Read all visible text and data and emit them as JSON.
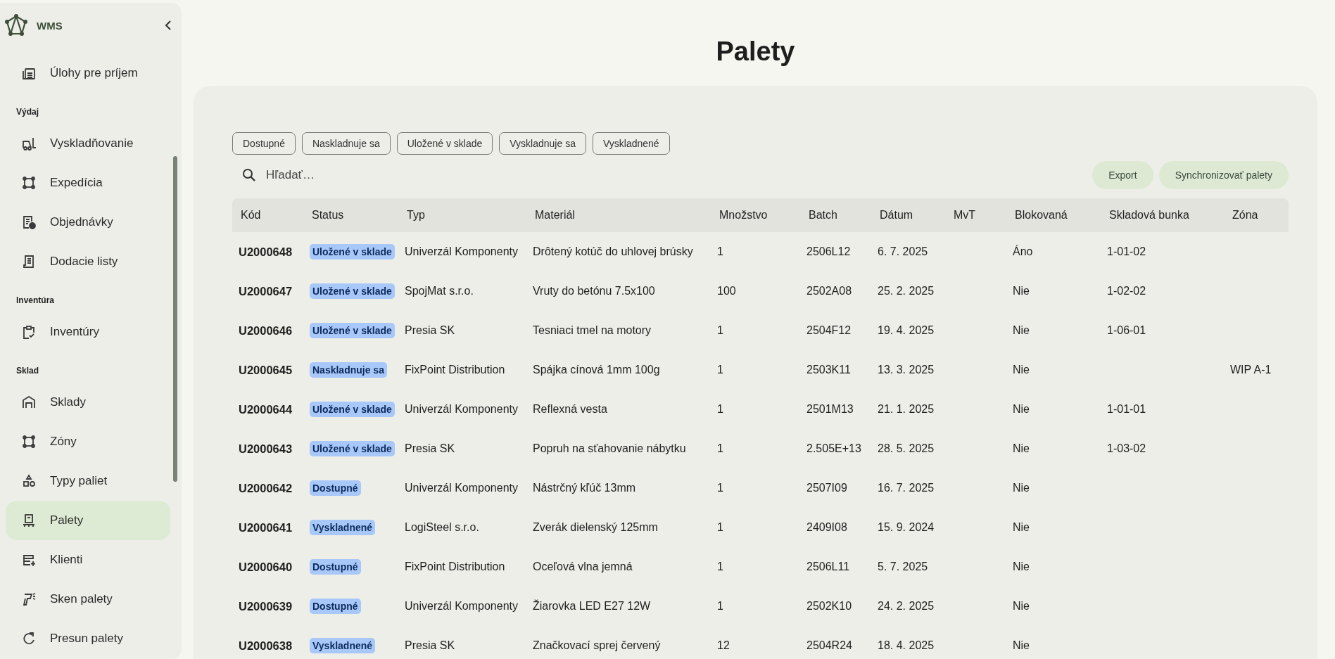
{
  "app": {
    "name": "WMS"
  },
  "sidebar": {
    "sections": [
      {
        "items": [
          {
            "label": "Úlohy pre príjem",
            "selected": false
          }
        ]
      },
      {
        "label": "Výdaj",
        "items": [
          {
            "label": "Vyskladňovanie",
            "selected": false
          },
          {
            "label": "Expedícia",
            "selected": false
          },
          {
            "label": "Objednávky",
            "selected": false
          },
          {
            "label": "Dodacie listy",
            "selected": false
          }
        ]
      },
      {
        "label": "Inventúra",
        "items": [
          {
            "label": "Inventúry",
            "selected": false
          }
        ]
      },
      {
        "label": "Sklad",
        "items": [
          {
            "label": "Sklady",
            "selected": false
          },
          {
            "label": "Zóny",
            "selected": false
          },
          {
            "label": "Typy paliet",
            "selected": false
          },
          {
            "label": "Palety",
            "selected": true
          },
          {
            "label": "Klienti",
            "selected": false
          },
          {
            "label": "Sken palety",
            "selected": false
          },
          {
            "label": "Presun palety",
            "selected": false
          }
        ]
      }
    ]
  },
  "page_title": "Palety",
  "filters": [
    {
      "label": "Dostupné",
      "selected": false
    },
    {
      "label": "Naskladnuje sa",
      "selected": false
    },
    {
      "label": "Uložené v sklade",
      "selected": false
    },
    {
      "label": "Vyskladnuje sa",
      "selected": false
    },
    {
      "label": "Vyskladnené",
      "selected": false
    }
  ],
  "search": {
    "placeholder": "Hľadať…"
  },
  "actions": [
    "Export",
    "Synchronizovať palety"
  ],
  "table": {
    "columns": [
      "Kód",
      "Status",
      "Typ",
      "Materiál",
      "Množstvo",
      "Batch",
      "Dátum",
      "MvT",
      "Blokovaná",
      "Skladová bunka",
      "Zóna"
    ],
    "rows": [
      {
        "code": "U2000648",
        "status": "Uložené v sklade",
        "type": "Univerzál Komponenty",
        "material": "Drôtený kotúč do uhlovej brúsky",
        "quantity": "1",
        "batch": "2506L12",
        "date": "6. 7. 2025",
        "blocked": "Áno",
        "cell": "1-01-02"
      },
      {
        "code": "U2000647",
        "status": "Uložené v sklade",
        "type": "SpojMat s.r.o.",
        "material": "Vruty do betónu 7.5x100",
        "quantity": "100",
        "batch": "2502A08",
        "date": "25. 2. 2025",
        "blocked": "Nie",
        "cell": "1-02-02"
      },
      {
        "code": "U2000646",
        "status": "Uložené v sklade",
        "type": "Presia SK",
        "material": "Tesniaci tmel na motory",
        "quantity": "1",
        "batch": "2504F12",
        "date": "19. 4. 2025",
        "blocked": "Nie",
        "cell": "1-06-01"
      },
      {
        "code": "U2000645",
        "status": "Naskladnuje sa",
        "type": "FixPoint Distribution",
        "material": "Spájka cínová 1mm 100g",
        "quantity": "1",
        "batch": "2503K11",
        "date": "13. 3. 2025",
        "blocked": "Nie",
        "zone": "WIP A-1"
      },
      {
        "code": "U2000644",
        "status": "Uložené v sklade",
        "type": "Univerzál Komponenty",
        "material": "Reflexná vesta",
        "quantity": "1",
        "batch": "2501M13",
        "date": "21. 1. 2025",
        "blocked": "Nie",
        "cell": "1-01-01"
      },
      {
        "code": "U2000643",
        "status": "Uložené v sklade",
        "type": "Presia SK",
        "material": "Popruh na sťahovanie nábytku",
        "quantity": "1",
        "batch": "2.505E+13",
        "date": "28. 5. 2025",
        "blocked": "Nie",
        "cell": "1-03-02"
      },
      {
        "code": "U2000642",
        "status": "Dostupné",
        "type": "Univerzál Komponenty",
        "material": "Nástrčný kľúč 13mm",
        "quantity": "1",
        "batch": "2507I09",
        "date": "16. 7. 2025",
        "blocked": "Nie"
      },
      {
        "code": "U2000641",
        "status": "Vyskladnené",
        "type": "LogiSteel s.r.o.",
        "material": "Zverák dielenský 125mm",
        "quantity": "1",
        "batch": "2409I08",
        "date": "15. 9. 2024",
        "blocked": "Nie"
      },
      {
        "code": "U2000640",
        "status": "Dostupné",
        "type": "FixPoint Distribution",
        "material": "Oceľová vlna jemná",
        "quantity": "1",
        "batch": "2506L11",
        "date": "5. 7. 2025",
        "blocked": "Nie"
      },
      {
        "code": "U2000639",
        "status": "Dostupné",
        "type": "Univerzál Komponenty",
        "material": "Žiarovka LED E27 12W",
        "quantity": "1",
        "batch": "2502K10",
        "date": "24. 2. 2025",
        "blocked": "Nie"
      },
      {
        "code": "U2000638",
        "status": "Vyskladnené",
        "type": "Presia SK",
        "material": "Značkovací sprej červený",
        "quantity": "12",
        "batch": "2504R24",
        "date": "18. 4. 2025",
        "blocked": "Nie"
      }
    ]
  }
}
